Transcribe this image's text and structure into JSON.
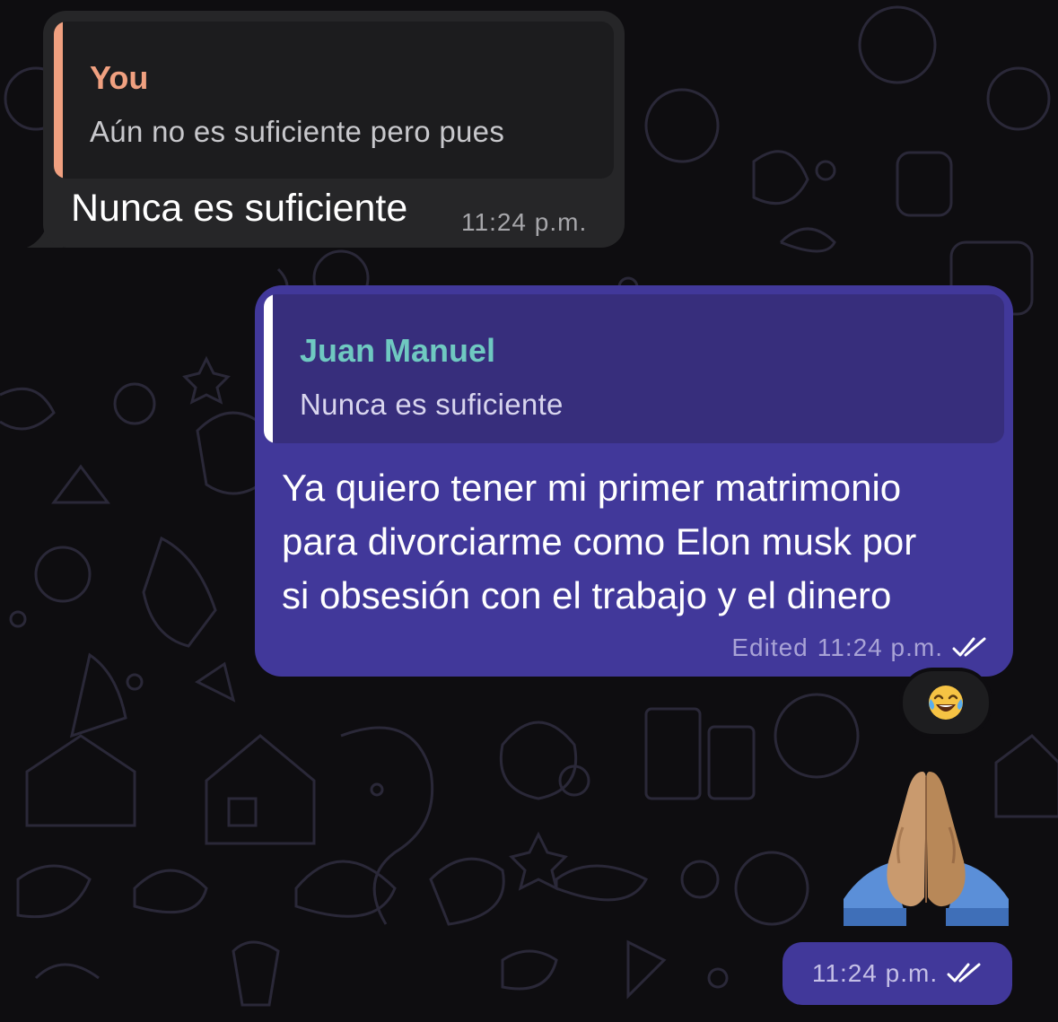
{
  "messages": {
    "incoming": {
      "reply_author": "You",
      "reply_text": "Aún no es suficiente pero pues",
      "text": "Nunca es suficiente",
      "time": "11:24 p.m."
    },
    "outgoing": {
      "reply_author": "Juan Manuel",
      "reply_text": "Nunca es suficiente",
      "text_lines": [
        "Ya quiero tener mi primer matrimonio",
        "para divorciarme como Elon musk por",
        "si obsesión con el trabajo y el dinero"
      ],
      "edited_label": "Edited",
      "time": "11:24 p.m.",
      "status_icon": "double-check-icon",
      "reaction_icon": "face-with-tears-of-joy-emoji"
    },
    "emoji_message": {
      "emoji_icon": "folded-hands-emoji",
      "time": "11:24 p.m.",
      "status_icon": "double-check-icon"
    }
  },
  "colors": {
    "background": "#0e0d10",
    "incoming_bubble": "#262628",
    "outgoing_bubble": "#41389a",
    "you_accent": "#f0a080",
    "contact_accent": "#6fc9c1"
  }
}
